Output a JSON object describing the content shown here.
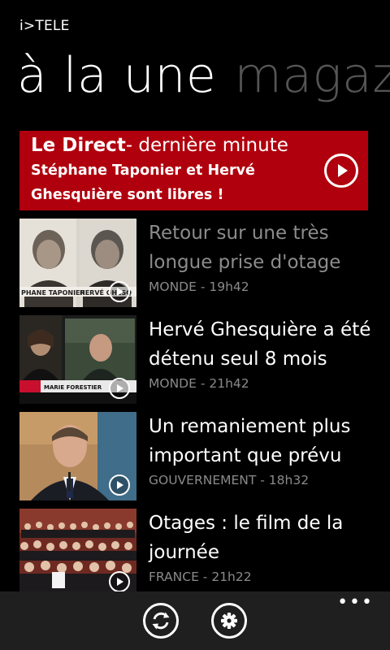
{
  "app": {
    "title": "i>TELE"
  },
  "pivot": {
    "active": "à la une",
    "next": "magazine"
  },
  "direct": {
    "label_bold": "Le Direct",
    "label_rest": "- dernière minute",
    "headline": "Stéphane Taponier et Hervé Ghesquière sont libres !",
    "icon": "play-icon",
    "accent": "#b0000d"
  },
  "news": [
    {
      "title": "Retour sur une très longue prise d'otage",
      "category": "MONDE",
      "time": "19h42",
      "read": true,
      "thumb_caption_left": "PHANE TAPONIER",
      "thumb_caption_right": "HERVÉ GHESQ"
    },
    {
      "title": "Hervé Ghesquière a été détenu seul 8 mois",
      "category": "MONDE",
      "time": "21h42",
      "read": false,
      "thumb_caption": "MARIE FORESTIER"
    },
    {
      "title": "Un remaniement plus important que prévu",
      "category": "GOUVERNEMENT",
      "time": "18h32",
      "read": false
    },
    {
      "title": "Otages : le film de la journée",
      "category": "FRANCE",
      "time": "21h22",
      "read": false
    }
  ],
  "meta_separator": " - ",
  "app_bar": {
    "buttons": [
      {
        "name": "refresh-button",
        "icon": "refresh-icon"
      },
      {
        "name": "settings-button",
        "icon": "gear-icon"
      }
    ],
    "more": "•••"
  }
}
